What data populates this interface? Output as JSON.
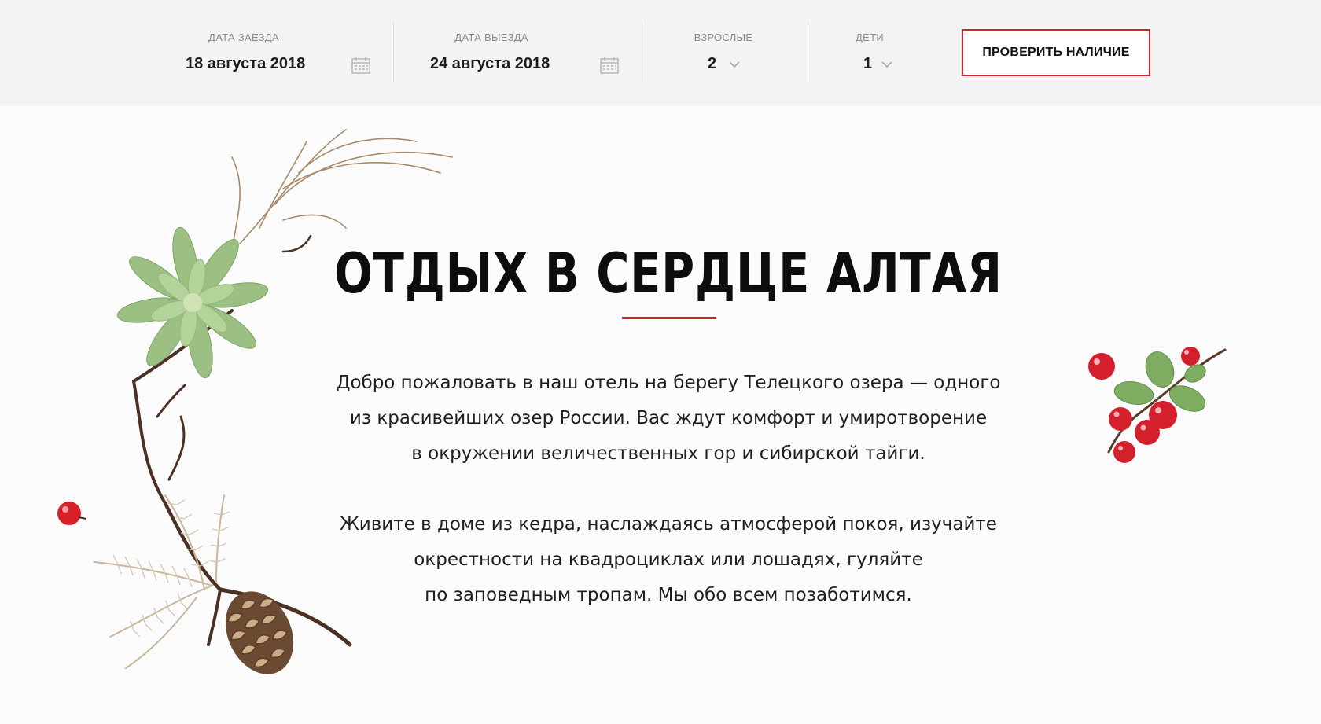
{
  "booking": {
    "checkin": {
      "label": "ДАТА ЗАЕЗДА",
      "value": "18 августа 2018",
      "icon": "calendar-icon"
    },
    "checkout": {
      "label": "ДАТА ВЫЕЗДА",
      "value": "24 августа 2018",
      "icon": "calendar-icon"
    },
    "adults": {
      "label": "ВЗРОСЛЫЕ",
      "value": "2",
      "icon": "chevron-down-icon"
    },
    "children": {
      "label": "ДЕТИ",
      "value": "1",
      "icon": "chevron-down-icon"
    },
    "submit_label": "ПРОВЕРИТЬ НАЛИЧИЕ"
  },
  "hero": {
    "title": "ОТДЫХ В СЕРДЦЕ АЛТАЯ",
    "paragraph1": [
      "Добро пожаловать в наш отель на берегу Телецкого озера — одного",
      "из красивейших озер России. Вас ждут комфорт и умиротворение",
      "в окружении величественных гор и сибирской тайги."
    ],
    "paragraph2": [
      "Живите в доме из кедра, наслаждаясь атмосферой покоя, изучайте",
      "окрестности на квадроциклах или лошадях, гуляйте",
      "по заповедным тропам. Мы обо всем позаботимся."
    ]
  },
  "colors": {
    "accent": "#d0252b",
    "bar_background": "#f3f3f3",
    "page_background": "#fbfbfb"
  }
}
